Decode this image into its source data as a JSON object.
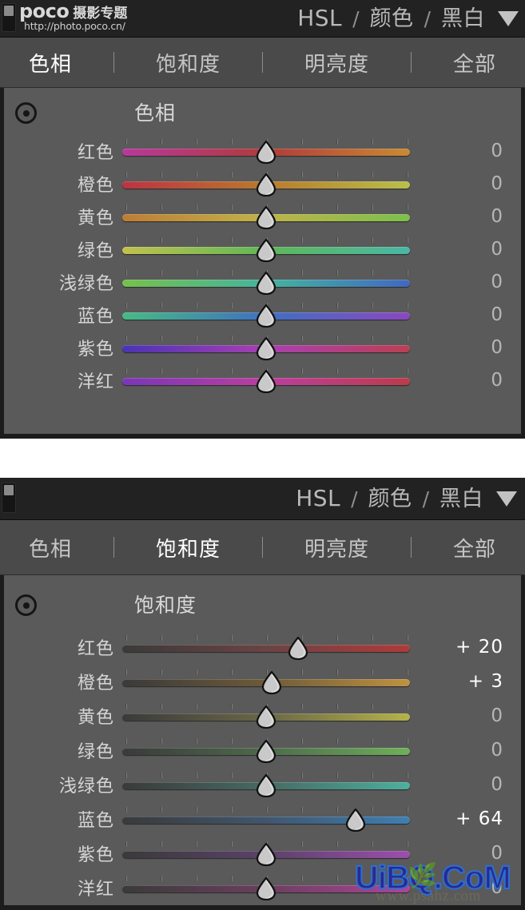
{
  "branding": {
    "name": "poco 摄影专题",
    "name_latin": "poco",
    "name_cjk": "摄影专题",
    "url": "http://photo.poco.cn/"
  },
  "header": {
    "mode_hsl": "HSL",
    "sep1": "/",
    "mode_color": "颜色",
    "sep2": "/",
    "mode_bw": "黑白",
    "caret": "chevron-down-icon"
  },
  "tabs": {
    "hue": "色相",
    "saturation": "饱和度",
    "luminance": "明亮度",
    "all": "全部"
  },
  "colors": {
    "panel_frame": "#1c1c1c",
    "titlebar": "#222222",
    "tabstrip": "#4a4a4a",
    "body": "#5a5a5a",
    "text": "#d5d5d5",
    "text_active": "#ffffff",
    "value_zero": "#b6b6b6",
    "watermark": "#2b6fd4"
  },
  "panel_hue": {
    "active_tab": "色相",
    "section_title": "色相",
    "target_icon": "target-icon",
    "rows": [
      {
        "label": "红色",
        "value": "0",
        "pos": 50,
        "from": "#b8389c",
        "via": "#b03b3b",
        "to": "#c98a33"
      },
      {
        "label": "橙色",
        "value": "0",
        "pos": 50,
        "from": "#bb3343",
        "via": "#b97a2e",
        "to": "#b8c04a"
      },
      {
        "label": "黄色",
        "value": "0",
        "pos": 50,
        "from": "#bf7c35",
        "via": "#bfb347",
        "to": "#7cc04b"
      },
      {
        "label": "绿色",
        "value": "0",
        "pos": 50,
        "from": "#c2c14c",
        "via": "#5eb857",
        "to": "#49b7a8"
      },
      {
        "label": "浅绿色",
        "value": "0",
        "pos": 50,
        "from": "#76c04c",
        "via": "#45b49f",
        "to": "#4168c0"
      },
      {
        "label": "蓝色",
        "value": "0",
        "pos": 50,
        "from": "#46bb84",
        "via": "#3f70c2",
        "to": "#8b47c0"
      },
      {
        "label": "紫色",
        "value": "0",
        "pos": 50,
        "from": "#4a33b5",
        "via": "#a93fb2",
        "to": "#bb3f52"
      },
      {
        "label": "洋红",
        "value": "0",
        "pos": 50,
        "from": "#7a36b8",
        "via": "#bb3f9e",
        "to": "#bb3c4a"
      }
    ]
  },
  "panel_saturation": {
    "active_tab": "饱和度",
    "section_title": "饱和度",
    "target_icon": "target-icon",
    "rows": [
      {
        "label": "红色",
        "value": "+ 20",
        "pos": 61,
        "from": "#3a3a3a",
        "via": "#6b4343",
        "to": "#b03a3a"
      },
      {
        "label": "橙色",
        "value": "+ 3",
        "pos": 52,
        "from": "#3a3a3a",
        "via": "#6d5a38",
        "to": "#c09241"
      },
      {
        "label": "黄色",
        "value": "0",
        "pos": 50,
        "from": "#3a3a3a",
        "via": "#6a6747",
        "to": "#b5b24a"
      },
      {
        "label": "绿色",
        "value": "0",
        "pos": 50,
        "from": "#3a3a3a",
        "via": "#4e6a4c",
        "to": "#6fb05a"
      },
      {
        "label": "浅绿色",
        "value": "0",
        "pos": 50,
        "from": "#3a3a3a",
        "via": "#466a63",
        "to": "#4cb09e"
      },
      {
        "label": "蓝色",
        "value": "+ 64",
        "pos": 81,
        "from": "#3a3a3a",
        "via": "#40566e",
        "to": "#3d7fb4"
      },
      {
        "label": "紫色",
        "value": "0",
        "pos": 50,
        "from": "#3a3a3a",
        "via": "#5a4268",
        "to": "#9c4fae"
      },
      {
        "label": "洋红",
        "value": "0",
        "pos": 50,
        "from": "#3a3a3a",
        "via": "#6a3f5e",
        "to": "#b0439a"
      }
    ]
  },
  "watermark": {
    "text": "UiBQ.CoM",
    "sub": "www.psahz.com"
  }
}
